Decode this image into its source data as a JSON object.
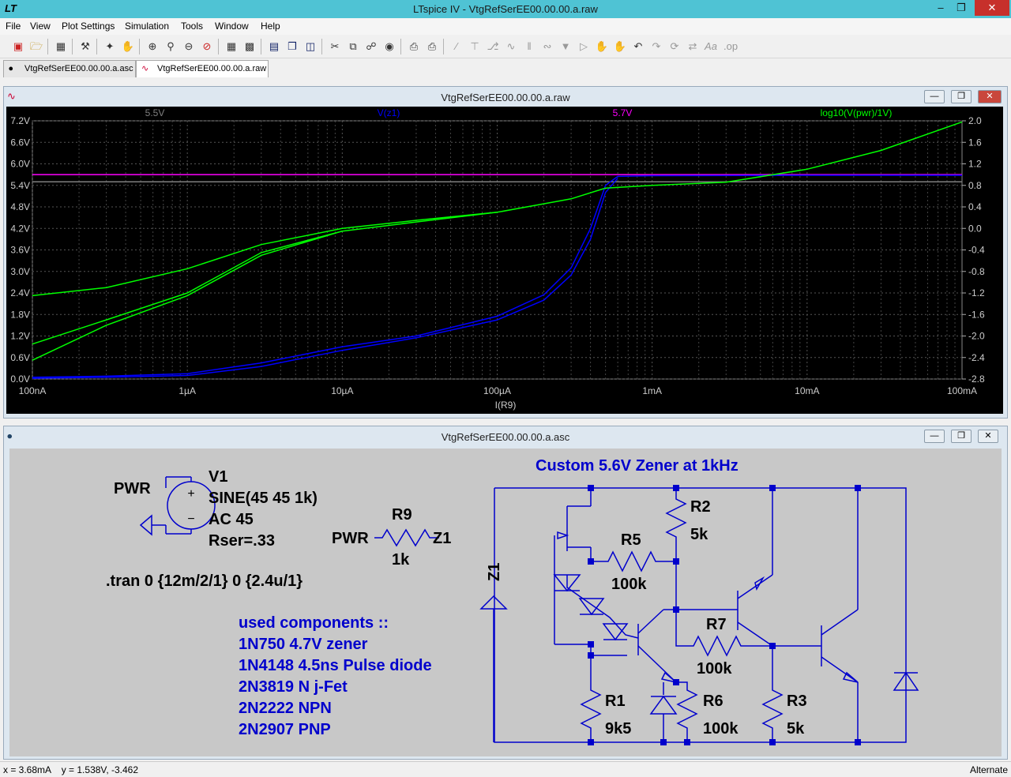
{
  "window": {
    "app_title": "LTspice IV - VtgRefSerEE00.00.00.a.raw",
    "minimize": "–",
    "restore": "❐",
    "close": "✕"
  },
  "menu": [
    "File",
    "View",
    "Plot Settings",
    "Simulation",
    "Tools",
    "Window",
    "Help"
  ],
  "tabs": [
    {
      "label": "VtgRefSerEE00.00.00.a.asc",
      "icon": "schematic-icon"
    },
    {
      "label": "VtgRefSerEE00.00.00.a.raw",
      "icon": "waveform-icon"
    }
  ],
  "plot_window": {
    "title": "VtgRefSerEE00.00.00.a.raw",
    "traces": {
      "t1": "5.5V",
      "t2": "V(z1)",
      "t3": "5.7V",
      "t4": "log10(V(pwr)/1V)"
    },
    "colors": {
      "t1": "#7f7f7f",
      "t2": "#0000ff",
      "t3": "#ff00ff",
      "t4": "#00ff00"
    }
  },
  "chart_data": {
    "type": "line",
    "xlabel": "I(R9)",
    "x_scale": "log",
    "x_ticks": [
      "100nA",
      "1µA",
      "10µA",
      "100µA",
      "1mA",
      "10mA",
      "100mA"
    ],
    "x_range": [
      1e-07,
      0.1
    ],
    "y_left_ticks": [
      "7.2V",
      "6.6V",
      "6.0V",
      "5.4V",
      "4.8V",
      "4.2V",
      "3.6V",
      "3.0V",
      "2.4V",
      "1.8V",
      "1.2V",
      "0.6V",
      "0.0V"
    ],
    "y_left_range": [
      0,
      7.2
    ],
    "y_right_ticks": [
      "2.0",
      "1.6",
      "1.2",
      "0.8",
      "0.4",
      "0.0",
      "-0.4",
      "-0.8",
      "-1.2",
      "-1.6",
      "-2.0",
      "-2.4",
      "-2.8"
    ],
    "y_right_range": [
      -2.8,
      2.0
    ],
    "grid": true,
    "series": [
      {
        "name": "5.5V",
        "axis": "left",
        "color": "#7f7f7f",
        "x": [
          1e-07,
          0.1
        ],
        "y": [
          5.5,
          5.5
        ]
      },
      {
        "name": "5.7V",
        "axis": "left",
        "color": "#ff00ff",
        "x": [
          1e-07,
          0.1
        ],
        "y": [
          5.7,
          5.7
        ]
      },
      {
        "name": "V(z1)",
        "axis": "left",
        "color": "#0000ff",
        "x": [
          1e-07,
          3e-07,
          1e-06,
          3e-06,
          1e-05,
          3e-05,
          0.0001,
          0.0002,
          0.0003,
          0.0004,
          0.0005,
          0.0006,
          0.001,
          0.01,
          0.1
        ],
        "y": [
          0.05,
          0.08,
          0.15,
          0.45,
          0.9,
          1.2,
          1.75,
          2.35,
          3.1,
          4.2,
          5.4,
          5.65,
          5.67,
          5.68,
          5.68
        ]
      },
      {
        "name": "V(z1) (return)",
        "axis": "left",
        "color": "#0000ff",
        "x": [
          1e-07,
          3e-07,
          1e-06,
          3e-06,
          1e-05,
          3e-05,
          0.0001,
          0.0002,
          0.0003,
          0.0004,
          0.0005,
          0.0006
        ],
        "y": [
          0.02,
          0.05,
          0.1,
          0.35,
          0.8,
          1.15,
          1.65,
          2.2,
          2.9,
          3.9,
          5.2,
          5.6
        ]
      },
      {
        "name": "log10(V(pwr)/1V)",
        "axis": "right",
        "color": "#00ff00",
        "x": [
          1e-07,
          3e-07,
          1e-06,
          3e-06,
          1e-05,
          3e-05,
          0.0001,
          0.0003,
          0.0005,
          0.001,
          0.003,
          0.01,
          0.03,
          0.1
        ],
        "y": [
          -1.25,
          -1.1,
          -0.75,
          -0.3,
          0.0,
          0.15,
          0.3,
          0.55,
          0.75,
          0.8,
          0.86,
          1.1,
          1.45,
          1.98
        ]
      },
      {
        "name": "log10(V(pwr)/1V) (rise)",
        "axis": "right",
        "color": "#00ff00",
        "x": [
          1e-07,
          3e-07,
          1e-06,
          3e-06,
          1e-05,
          3e-05,
          0.0001
        ],
        "y": [
          -2.15,
          -1.7,
          -1.2,
          -0.45,
          -0.05,
          0.12,
          0.3
        ]
      },
      {
        "name": "log10(V(pwr)/1V) (start)",
        "axis": "right",
        "color": "#00ff00",
        "x": [
          1e-07,
          3e-07,
          1e-06,
          3e-06,
          1e-05
        ],
        "y": [
          -2.45,
          -1.8,
          -1.25,
          -0.5,
          -0.05
        ]
      }
    ]
  },
  "schematic_window": {
    "title": "VtgRefSerEE00.00.00.a.asc",
    "labels": {
      "pwr_flag": "PWR",
      "v1_name": "V1",
      "v1_value": "SINE(45 45 1k)",
      "v1_ac": "AC 45",
      "v1_rser": "Rser=.33",
      "r9_name": "R9",
      "r9_value": "1k",
      "r9_left": "PWR",
      "r9_right": "Z1",
      "tran": ".tran 0 {12m/2/1} 0 {2.4u/1}",
      "heading": "Custom 5.6V Zener at 1kHz",
      "z1_flag": "Z1",
      "r1_name": "R1",
      "r1_value": "9k5",
      "r2_name": "R2",
      "r2_value": "5k",
      "r3_name": "R3",
      "r3_value": "5k",
      "r5_name": "R5",
      "r5_value": "100k",
      "r6_name": "R6",
      "r6_value": "100k",
      "r7_name": "R7",
      "r7_value": "100k"
    },
    "components_note": [
      "used components ::",
      "1N750 4.7V zener",
      "1N4148 4.5ns Pulse diode",
      "2N3819 N j-Fet",
      "2N2222 NPN",
      "2N2907 PNP"
    ]
  },
  "statusbar": {
    "cursor": "x = 3.68mA    y = 1.538V, -3.462",
    "mode": "Alternate"
  }
}
